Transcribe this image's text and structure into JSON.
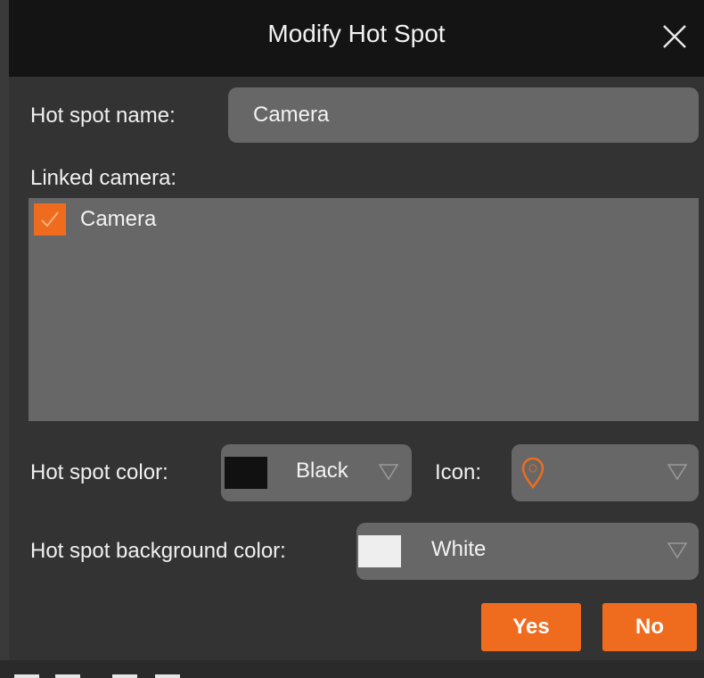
{
  "dialog": {
    "title": "Modify Hot Spot",
    "close_icon": "close-icon"
  },
  "form": {
    "name_label": "Hot spot name:",
    "name_value": "Camera",
    "linked_camera_label": "Linked camera:",
    "cameras": [
      {
        "label": "Camera",
        "checked": true
      }
    ],
    "hot_spot_color_label": "Hot spot color:",
    "hot_spot_color_value": "Black",
    "hot_spot_color_swatch": "#111111",
    "icon_label": "Icon:",
    "icon_value": "map-pin-icon",
    "background_color_label": "Hot spot background color:",
    "background_color_value": "White",
    "background_color_swatch": "#eeeeee"
  },
  "buttons": {
    "yes": "Yes",
    "no": "No"
  },
  "colors": {
    "accent": "#ef6c1f",
    "titlebar": "#141414",
    "dialog_bg": "#333333",
    "field_bg": "#676767"
  }
}
